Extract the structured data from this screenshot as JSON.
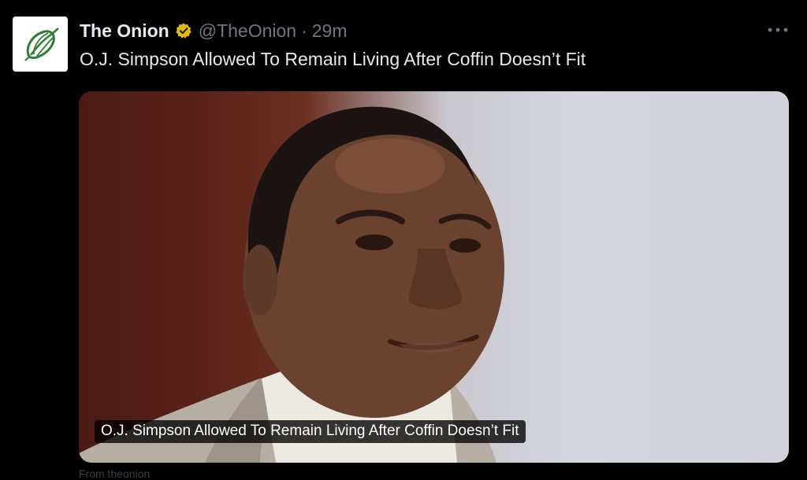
{
  "post": {
    "author_name": "The Onion",
    "handle": "@TheOnion",
    "separator": "·",
    "time": "29m",
    "text": "O.J. Simpson Allowed To Remain Living After Coffin Doesn’t Fit",
    "media_caption": "O.J. Simpson Allowed To Remain Living After Coffin Doesn’t Fit",
    "partial_footer": "From theonion"
  },
  "icons": {
    "avatar": "onion-logo-icon",
    "verified": "verified-badge-icon",
    "more": "more-options-icon"
  },
  "colors": {
    "background": "#000000",
    "primary_text": "#e7e9ea",
    "secondary_text": "#71767b",
    "verified_gold": "#e2b719",
    "onion_green": "#2e7d32"
  }
}
